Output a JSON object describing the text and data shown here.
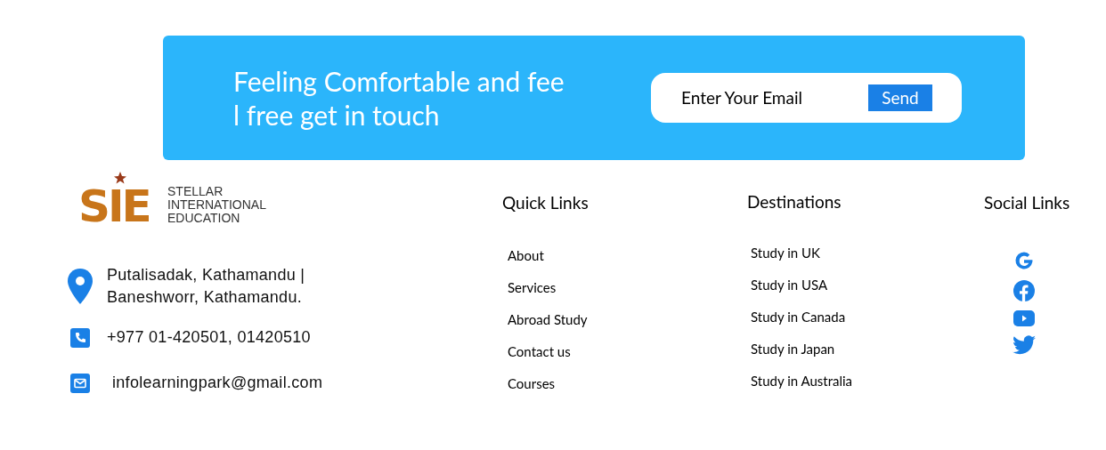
{
  "banner": {
    "heading_lines": [
      "Feeling Comfortable and fee",
      "l free get in touch"
    ],
    "email_field": {
      "placeholder": "Enter Your Email"
    },
    "send_button": "Send"
  },
  "logo": {
    "mark": "SIE",
    "name_lines": [
      "STELLAR",
      "INTERNATIONAL",
      "EDUCATION"
    ]
  },
  "contact": [
    {
      "kind": "address",
      "lines": [
        "Putalisadak, Kathamandu |",
        "Baneshworr, Kathamandu."
      ]
    },
    {
      "kind": "phone",
      "lines": [
        "+977 01-420501, 01420510"
      ]
    },
    {
      "kind": "email",
      "lines": [
        "infolearningpark@gmail.com"
      ]
    }
  ],
  "quick_links": {
    "title": "Quick Links",
    "items": [
      "About",
      "Services",
      "Abroad Study",
      "Contact us",
      "Courses"
    ]
  },
  "destinations": {
    "title": "Destinations",
    "items": [
      "Study in UK",
      "Study in USA",
      "Study in Canada",
      "Study in Japan",
      "Study in Australia"
    ]
  },
  "social_links": {
    "title": "Social Links",
    "items": [
      {
        "kind": "google"
      },
      {
        "kind": "facebook"
      },
      {
        "kind": "youtube"
      },
      {
        "kind": "twitter"
      }
    ]
  }
}
